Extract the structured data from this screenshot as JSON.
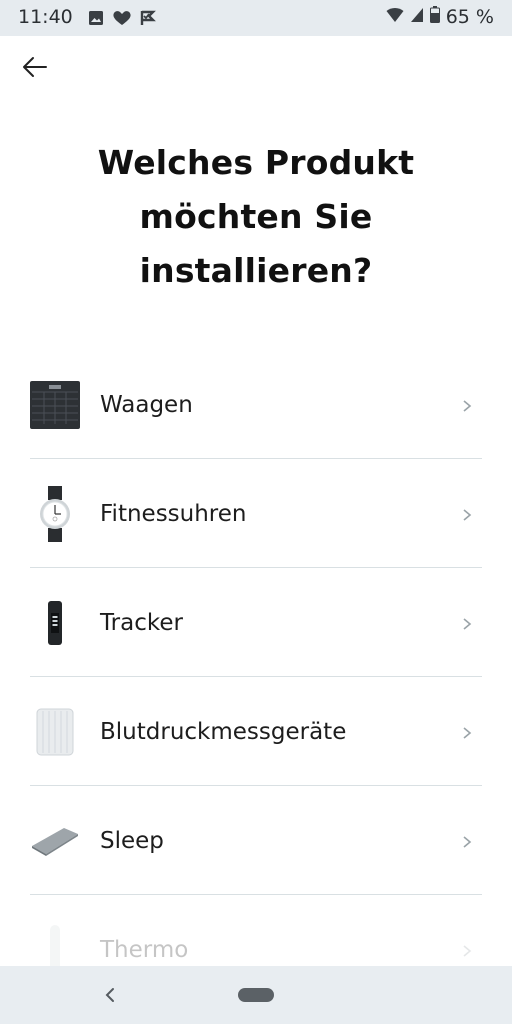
{
  "status_bar": {
    "time": "11:40",
    "battery": "65 %",
    "icons": [
      "image-icon",
      "heart-icon",
      "check-flag-icon",
      "wifi-icon",
      "signal-icon",
      "battery-icon"
    ]
  },
  "header": {
    "back_icon": "arrow-left-icon",
    "title": "Welches Produkt\nmöchten Sie\ninstallieren?"
  },
  "products": [
    {
      "label": "Waagen",
      "icon": "scale-icon"
    },
    {
      "label": "Fitnessuhren",
      "icon": "watch-icon"
    },
    {
      "label": "Tracker",
      "icon": "tracker-icon"
    },
    {
      "label": "Blutdruckmessgeräte",
      "icon": "blood-pressure-cuff-icon"
    },
    {
      "label": "Sleep",
      "icon": "sleep-pad-icon"
    },
    {
      "label": "Thermo",
      "icon": "thermometer-icon"
    }
  ],
  "nav_bar": {
    "back_icon": "nav-back-icon",
    "home_icon": "home-pill-icon"
  },
  "colors": {
    "status_bar_bg": "#e6ebef",
    "divider": "#d9e0e3",
    "text": "#1d1d1d",
    "chevron": "#9aa3a8"
  }
}
